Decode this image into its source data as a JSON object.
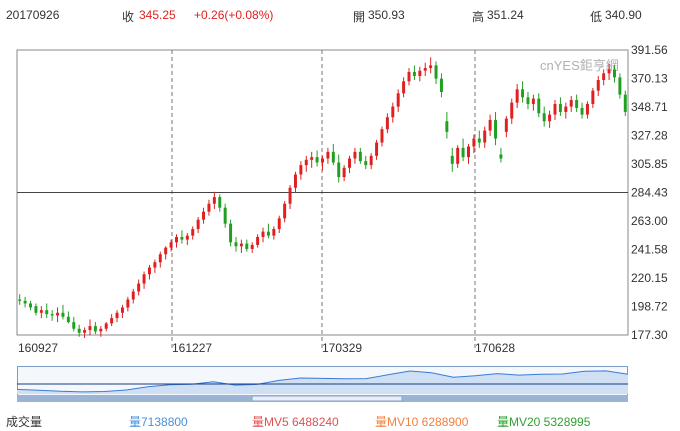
{
  "header": {
    "date": "20170926",
    "close_label": "收",
    "close": "345.25",
    "change": "+0.26(+0.08%)",
    "open_label": "開",
    "open": "350.93",
    "high_label": "高",
    "high": "351.24",
    "low_label": "低",
    "low": "340.90"
  },
  "watermark": "cnYES鉅亨網",
  "volume_bar": {
    "label": "成交量",
    "vol": "量7138800",
    "mv5": "量MV5 6488240",
    "mv10": "量MV10 6288900",
    "mv20": "量MV20 5328995"
  },
  "colors": {
    "up": "#e02020",
    "down": "#20a020",
    "vol_color": "#4a90d9",
    "mv5_color": "#e05050",
    "mv10_color": "#f08040",
    "mv20_color": "#30a030",
    "navigator_fill": "#cfe0f5",
    "navigator_line": "#3a7bd5"
  },
  "chart_data": {
    "type": "candlestick",
    "title": "",
    "xlabel": "",
    "ylabel": "",
    "ylim": [
      177.3,
      391.56
    ],
    "y_ticks": [
      "391.56",
      "370.13",
      "348.71",
      "327.28",
      "305.85",
      "284.43",
      "263.00",
      "241.58",
      "220.15",
      "198.72",
      "177.30"
    ],
    "x_ticks": [
      "160927",
      "161227",
      "170329",
      "170628"
    ],
    "reference_line": 284.43,
    "grid": "dashed vertical",
    "series": [
      {
        "values": [
          [
            204.0,
            208.0,
            200.0,
            203.0
          ],
          [
            203.0,
            206.0,
            198.0,
            201.0
          ],
          [
            201.0,
            203.0,
            196.0,
            198.0
          ],
          [
            199.0,
            201.0,
            192.0,
            194.0
          ],
          [
            194.0,
            199.0,
            190.0,
            196.0
          ],
          [
            196.0,
            201.0,
            190.0,
            193.0
          ],
          [
            193.0,
            196.0,
            188.0,
            192.0
          ],
          [
            192.0,
            198.0,
            187.0,
            194.0
          ],
          [
            194.0,
            200.0,
            189.0,
            191.0
          ],
          [
            191.0,
            195.0,
            186.0,
            187.0
          ],
          [
            187.0,
            191.0,
            180.0,
            182.0
          ],
          [
            182.0,
            185.0,
            176.0,
            179.0
          ],
          [
            179.0,
            183.0,
            175.0,
            181.0
          ],
          [
            181.0,
            189.0,
            177.0,
            184.0
          ],
          [
            184.0,
            187.0,
            178.0,
            180.0
          ],
          [
            180.0,
            184.0,
            176.0,
            182.0
          ],
          [
            182.0,
            187.0,
            180.0,
            186.0
          ],
          [
            186.0,
            193.0,
            184.0,
            190.0
          ],
          [
            190.0,
            196.0,
            187.0,
            194.0
          ],
          [
            194.0,
            200.0,
            190.0,
            198.0
          ],
          [
            198.0,
            206.0,
            195.0,
            204.0
          ],
          [
            204.0,
            212.0,
            201.0,
            210.0
          ],
          [
            210.0,
            219.0,
            207.0,
            216.0
          ],
          [
            216.0,
            225.0,
            212.0,
            223.0
          ],
          [
            223.0,
            230.0,
            219.0,
            228.0
          ],
          [
            228.0,
            234.0,
            224.0,
            232.0
          ],
          [
            232.0,
            240.0,
            228.0,
            238.0
          ],
          [
            238.0,
            244.0,
            234.0,
            243.0
          ],
          [
            243.0,
            249.0,
            240.0,
            247.0
          ],
          [
            247.0,
            253.0,
            243.0,
            251.0
          ],
          [
            251.0,
            256.0,
            246.0,
            249.0
          ],
          [
            249.0,
            254.0,
            245.0,
            252.0
          ],
          [
            252.0,
            259.0,
            249.0,
            257.0
          ],
          [
            257.0,
            266.0,
            254.0,
            264.0
          ],
          [
            264.0,
            273.0,
            261.0,
            270.0
          ],
          [
            270.0,
            279.0,
            267.0,
            276.0
          ],
          [
            276.0,
            285.0,
            272.0,
            281.0
          ],
          [
            281.0,
            283.0,
            270.0,
            273.0
          ],
          [
            273.0,
            276.0,
            258.0,
            261.0
          ],
          [
            261.0,
            264.0,
            244.0,
            247.0
          ],
          [
            247.0,
            251.0,
            240.0,
            244.0
          ],
          [
            244.0,
            249.0,
            239.0,
            246.0
          ],
          [
            246.0,
            249.0,
            240.0,
            242.0
          ],
          [
            242.0,
            247.0,
            239.0,
            245.0
          ],
          [
            245.0,
            253.0,
            243.0,
            251.0
          ],
          [
            251.0,
            258.0,
            247.0,
            255.0
          ],
          [
            255.0,
            261.0,
            250.0,
            252.0
          ],
          [
            252.0,
            259.0,
            249.0,
            257.0
          ],
          [
            257.0,
            267.0,
            254.0,
            265.0
          ],
          [
            265.0,
            278.0,
            262.0,
            276.0
          ],
          [
            276.0,
            290.0,
            272.0,
            288.0
          ],
          [
            288.0,
            300.0,
            284.0,
            298.0
          ],
          [
            298.0,
            308.0,
            294.0,
            305.0
          ],
          [
            305.0,
            312.0,
            300.0,
            309.0
          ],
          [
            309.0,
            315.0,
            303.0,
            311.0
          ],
          [
            311.0,
            316.0,
            304.0,
            307.0
          ],
          [
            307.0,
            312.0,
            301.0,
            310.0
          ],
          [
            310.0,
            318.0,
            306.0,
            315.0
          ],
          [
            315.0,
            321.0,
            305.0,
            307.0
          ],
          [
            307.0,
            313.0,
            292.0,
            296.0
          ],
          [
            296.0,
            305.0,
            293.0,
            303.0
          ],
          [
            303.0,
            312.0,
            299.0,
            310.0
          ],
          [
            310.0,
            318.0,
            306.0,
            315.0
          ],
          [
            315.0,
            318.0,
            306.0,
            308.0
          ],
          [
            308.0,
            312.0,
            302.0,
            305.0
          ],
          [
            305.0,
            314.0,
            302.0,
            312.0
          ],
          [
            312.0,
            324.0,
            309.0,
            322.0
          ],
          [
            322.0,
            334.0,
            319.0,
            332.0
          ],
          [
            332.0,
            344.0,
            329.0,
            341.0
          ],
          [
            341.0,
            352.0,
            337.0,
            349.0
          ],
          [
            349.0,
            362.0,
            345.0,
            359.0
          ],
          [
            359.0,
            371.0,
            356.0,
            368.0
          ],
          [
            368.0,
            378.0,
            365.0,
            375.0
          ],
          [
            375.0,
            380.0,
            369.0,
            372.0
          ],
          [
            372.0,
            379.0,
            368.0,
            376.0
          ],
          [
            376.0,
            382.0,
            372.0,
            378.0
          ],
          [
            378.0,
            386.0,
            374.0,
            380.0
          ],
          [
            380.0,
            383.0,
            366.0,
            370.0
          ],
          [
            370.0,
            374.0,
            356.0,
            360.0
          ],
          [
            338.0,
            345.0,
            325.0,
            330.0
          ],
          [
            312.0,
            318.0,
            300.0,
            306.0
          ],
          [
            306.0,
            320.0,
            303.0,
            318.0
          ],
          [
            318.0,
            325.0,
            308.0,
            311.0
          ],
          [
            311.0,
            321.0,
            306.0,
            319.0
          ],
          [
            319.0,
            328.0,
            314.0,
            325.0
          ],
          [
            325.0,
            331.0,
            318.0,
            322.0
          ],
          [
            322.0,
            334.0,
            318.0,
            331.0
          ],
          [
            331.0,
            343.0,
            327.0,
            339.0
          ],
          [
            339.0,
            345.0,
            320.0,
            325.0
          ],
          [
            313.0,
            318.0,
            307.0,
            310.0
          ],
          [
            330.0,
            342.0,
            326.0,
            340.0
          ],
          [
            340.0,
            355.0,
            336.0,
            352.0
          ],
          [
            352.0,
            366.0,
            348.0,
            362.0
          ],
          [
            362.0,
            368.0,
            352.0,
            356.0
          ],
          [
            356.0,
            360.0,
            347.0,
            351.0
          ],
          [
            351.0,
            358.0,
            346.0,
            355.0
          ],
          [
            355.0,
            359.0,
            341.0,
            344.0
          ],
          [
            344.0,
            349.0,
            334.0,
            338.0
          ],
          [
            338.0,
            346.0,
            333.0,
            343.0
          ],
          [
            343.0,
            354.0,
            339.0,
            351.0
          ],
          [
            351.0,
            356.0,
            342.0,
            345.0
          ],
          [
            345.0,
            352.0,
            340.0,
            349.0
          ],
          [
            349.0,
            357.0,
            345.0,
            354.0
          ],
          [
            354.0,
            358.0,
            345.0,
            348.0
          ],
          [
            348.0,
            352.0,
            340.0,
            343.0
          ],
          [
            343.0,
            353.0,
            340.0,
            351.0
          ],
          [
            351.0,
            363.0,
            348.0,
            361.0
          ],
          [
            361.0,
            372.0,
            357.0,
            369.0
          ],
          [
            369.0,
            377.0,
            365.0,
            374.0
          ],
          [
            374.0,
            381.0,
            369.0,
            377.0
          ],
          [
            377.0,
            380.0,
            367.0,
            371.0
          ],
          [
            371.0,
            374.0,
            355.0,
            358.0
          ],
          [
            358.0,
            361.0,
            342.0,
            345.0
          ]
        ]
      }
    ],
    "columns": [
      "open",
      "high",
      "low",
      "close"
    ],
    "navigator": {
      "values": [
        204,
        196,
        186,
        180,
        184,
        198,
        228,
        247,
        252,
        276,
        244,
        251,
        288,
        311,
        307,
        303,
        305,
        341,
        376,
        360,
        318,
        331,
        352,
        338,
        345,
        348,
        374,
        377,
        345
      ]
    }
  }
}
